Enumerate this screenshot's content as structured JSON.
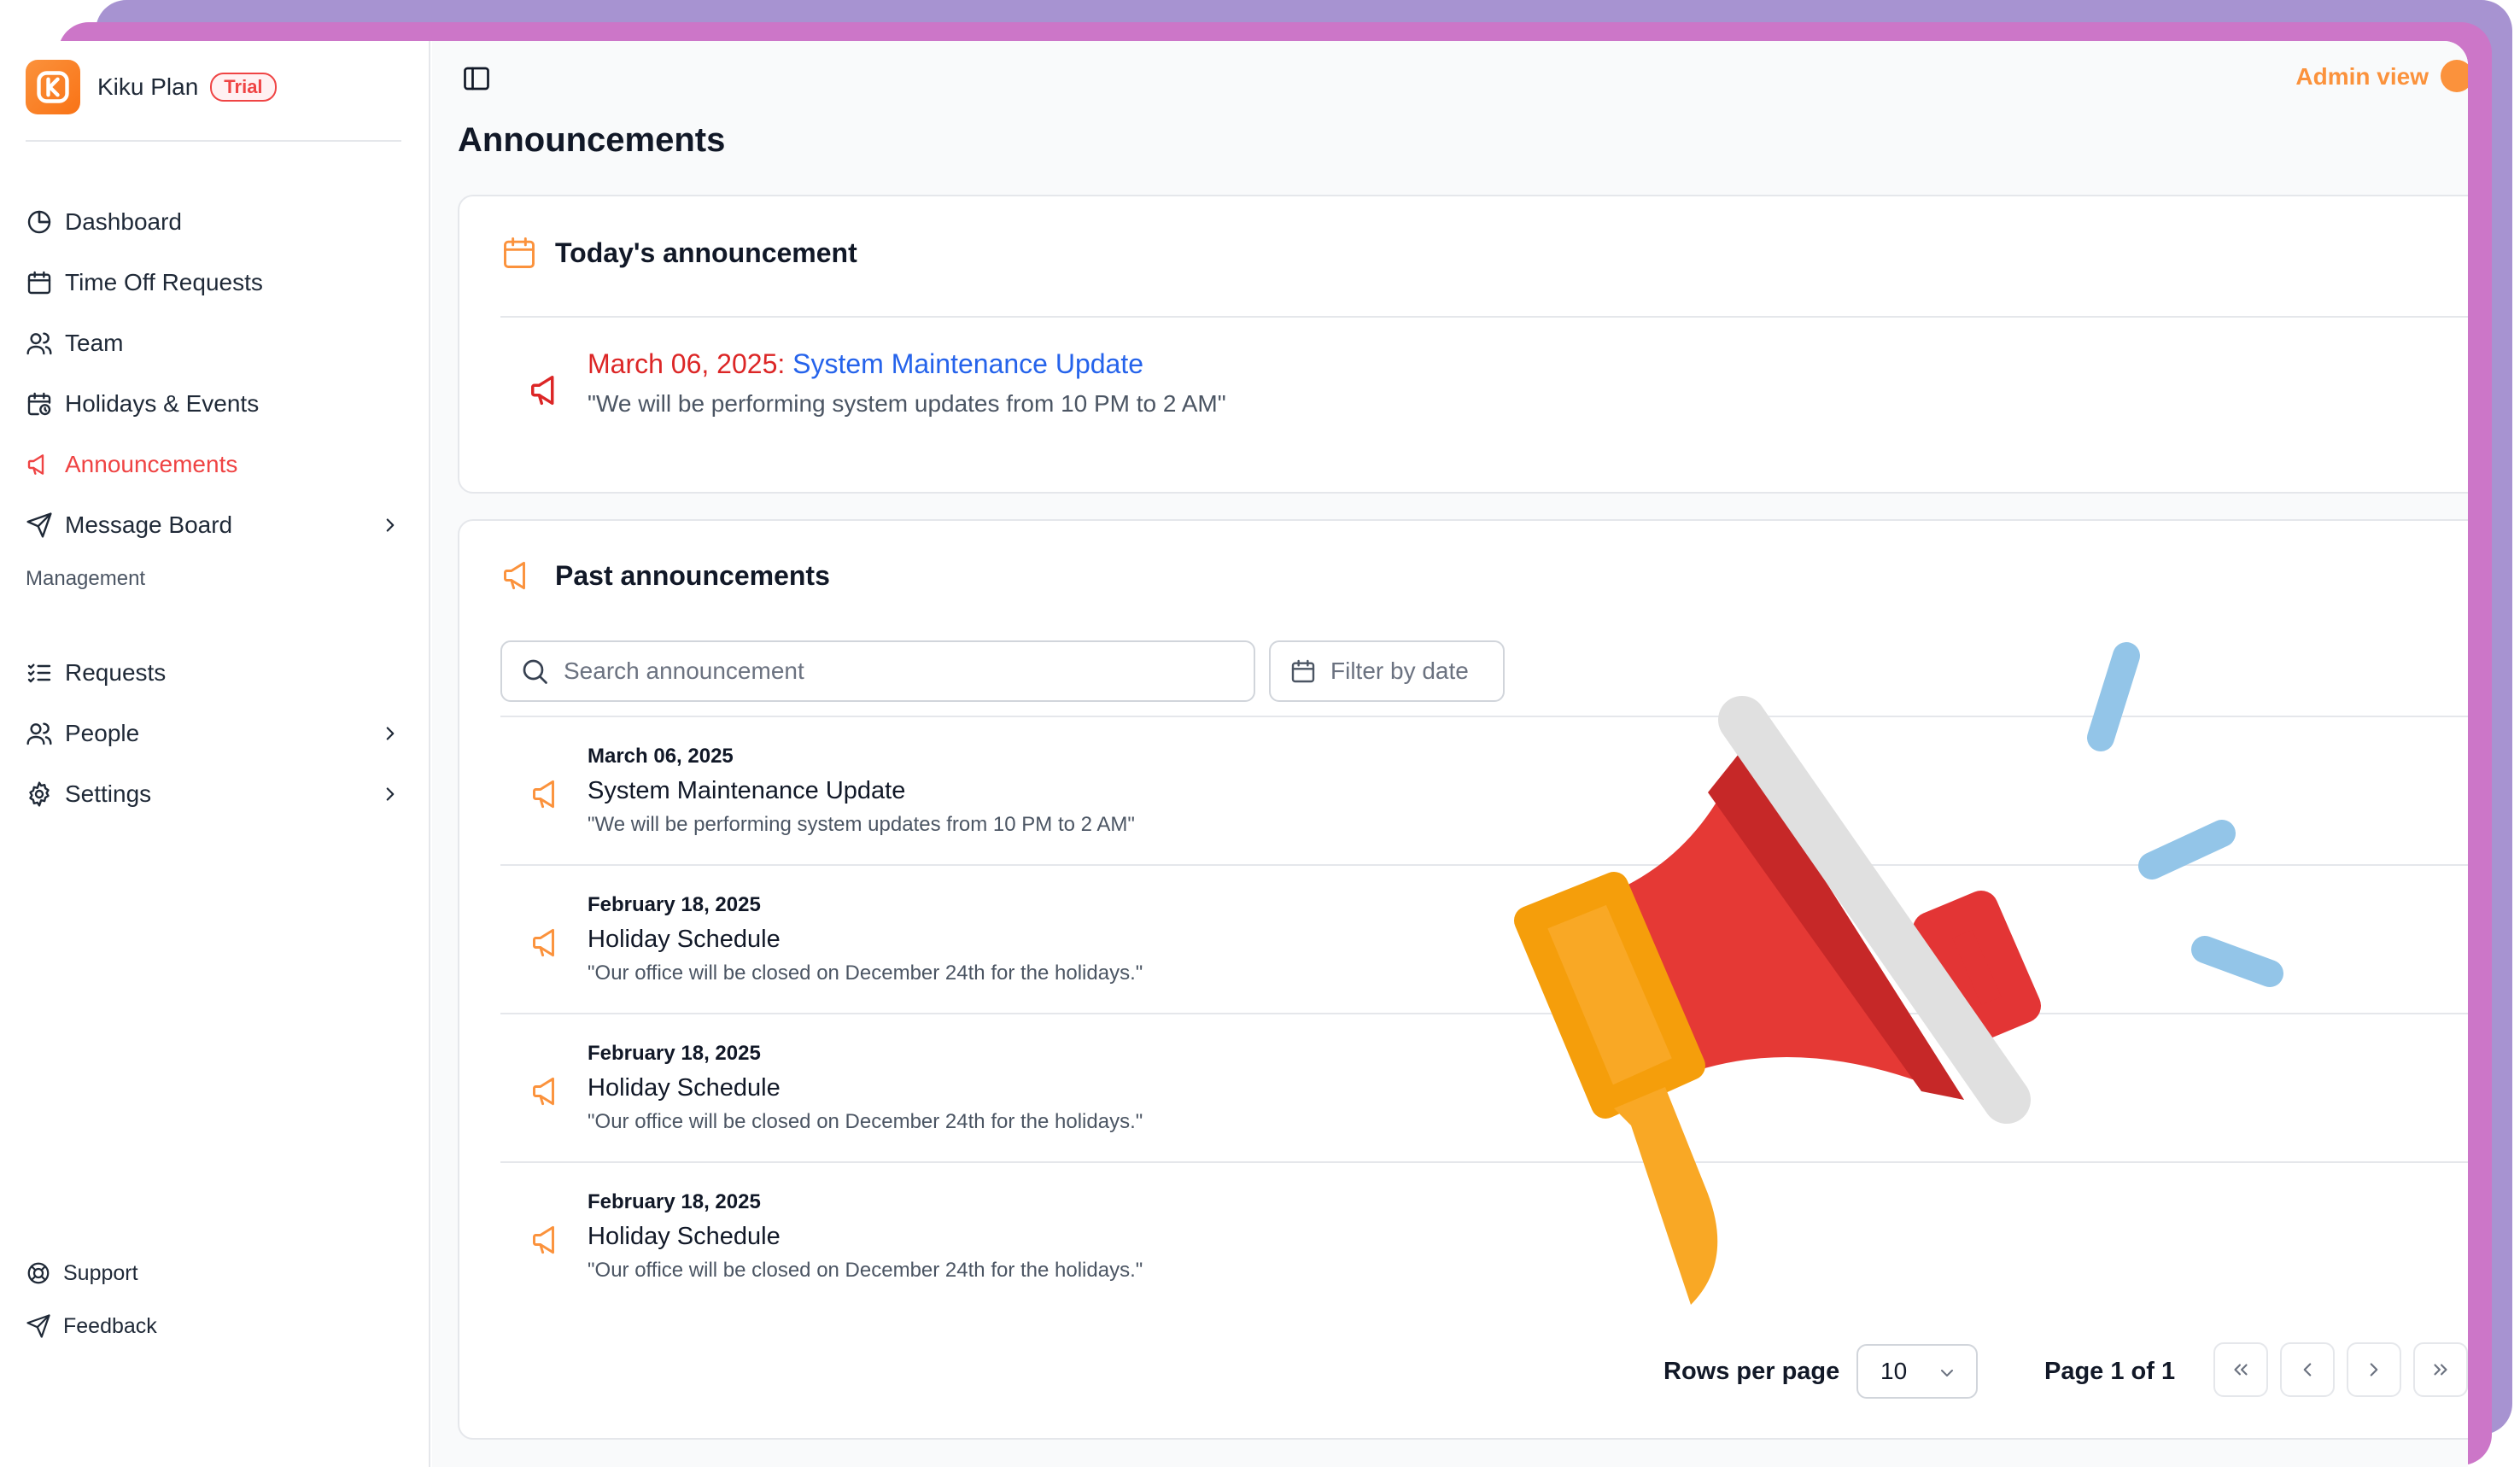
{
  "brand": {
    "name": "Kiku Plan",
    "badge": "Trial"
  },
  "sidebar": {
    "items": [
      {
        "label": "Dashboard",
        "icon": "pie-chart-icon"
      },
      {
        "label": "Time Off Requests",
        "icon": "calendar-icon"
      },
      {
        "label": "Team",
        "icon": "users-icon"
      },
      {
        "label": "Holidays & Events",
        "icon": "calendar-clock-icon"
      },
      {
        "label": "Announcements",
        "icon": "megaphone-icon",
        "active": true
      },
      {
        "label": "Message Board",
        "icon": "send-icon"
      }
    ],
    "management_label": "Management",
    "management_items": [
      {
        "label": "Requests",
        "icon": "list-checks-icon"
      },
      {
        "label": "People",
        "icon": "users-icon"
      },
      {
        "label": "Settings",
        "icon": "gear-icon"
      }
    ],
    "footer": [
      {
        "label": "Support",
        "icon": "life-buoy-icon"
      },
      {
        "label": "Feedback",
        "icon": "send-icon"
      }
    ]
  },
  "header": {
    "admin_view": "Admin view"
  },
  "page": {
    "title": "Announcements"
  },
  "today": {
    "heading": "Today's announcement",
    "date": "March 06, 2025:",
    "title": "System Maintenance Update",
    "description": "\"We will be performing system updates from 10 PM to 2 AM\""
  },
  "past": {
    "heading": "Past announcements",
    "search_placeholder": "Search announcement",
    "filter_label": "Filter by date",
    "rows": [
      {
        "date": "March 06, 2025",
        "title": "System Maintenance Update",
        "description": "\"We will be performing system updates from 10 PM to 2 AM\""
      },
      {
        "date": "February 18, 2025",
        "title": "Holiday Schedule",
        "description": "\"Our office will be closed on December 24th for the holidays.\""
      },
      {
        "date": "February 18, 2025",
        "title": "Holiday Schedule",
        "description": "\"Our office will be closed on December 24th for the holidays.\""
      },
      {
        "date": "February 18, 2025",
        "title": "Holiday Schedule",
        "description": "\"Our office will be closed on December 24th for the holidays.\""
      }
    ],
    "pagination": {
      "rows_per_page_label": "Rows per page",
      "rows_per_page": "10",
      "page_label": "Page 1 of 1"
    }
  },
  "colors": {
    "accent": "#fb923c",
    "active": "#ef4444",
    "link": "#2563eb"
  }
}
